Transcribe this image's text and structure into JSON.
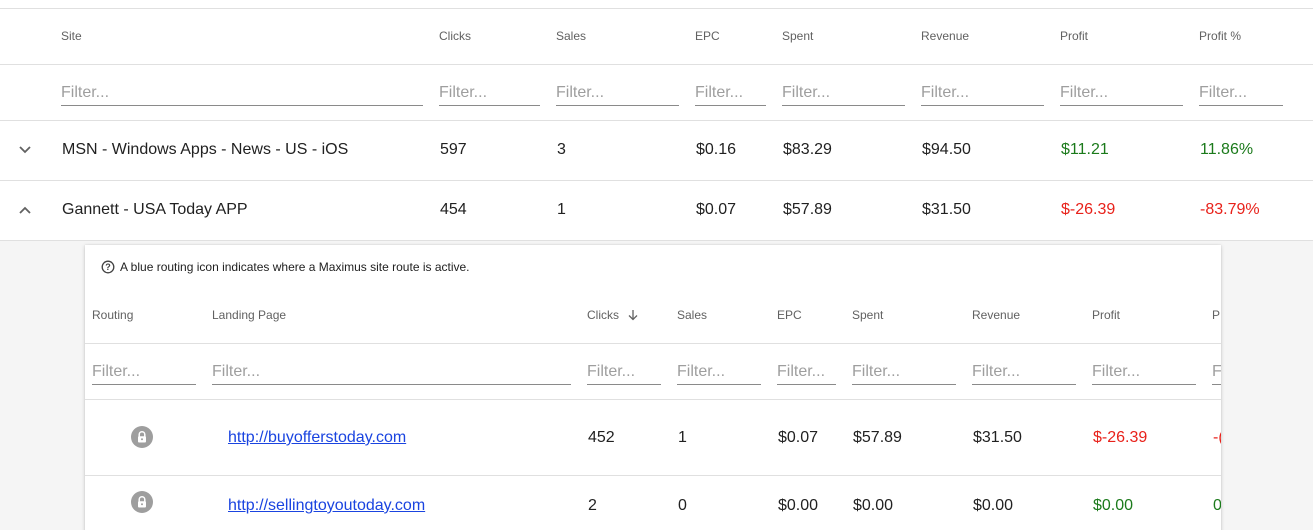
{
  "outer": {
    "columns": [
      "Site",
      "Clicks",
      "Sales",
      "EPC",
      "Spent",
      "Revenue",
      "Profit",
      "Profit %"
    ],
    "filter_placeholder": "Filter...",
    "rows": [
      {
        "expanded": false,
        "site": "MSN - Windows Apps - News - US - iOS",
        "clicks": "597",
        "sales": "3",
        "epc": "$0.16",
        "spent": "$83.29",
        "revenue": "$94.50",
        "profit": "$11.21",
        "profit_pct": "11.86%",
        "status": "positive"
      },
      {
        "expanded": true,
        "site": "Gannett - USA Today APP",
        "clicks": "454",
        "sales": "1",
        "epc": "$0.07",
        "spent": "$57.89",
        "revenue": "$31.50",
        "profit": "$-26.39",
        "profit_pct": "-83.79%",
        "status": "negative"
      }
    ]
  },
  "inner": {
    "note": "A blue routing icon indicates where a Maximus site route is active.",
    "columns": [
      "Routing",
      "Landing Page",
      "Clicks",
      "Sales",
      "EPC",
      "Spent",
      "Revenue",
      "Profit",
      "P"
    ],
    "sort_column": "Clicks",
    "sort_direction": "descending",
    "filter_placeholder": "Filter...",
    "filter_last": "F",
    "rows": [
      {
        "routing_icon": "lock-icon",
        "landing_page": "http://buyofferstoday.com",
        "clicks": "452",
        "sales": "1",
        "epc": "$0.07",
        "spent": "$57.89",
        "revenue": "$31.50",
        "profit": "$-26.39",
        "profit_pct_partial": "-(",
        "status": "negative"
      },
      {
        "routing_icon": "lock-icon",
        "landing_page": "http://sellingtoyoutoday.com",
        "clicks": "2",
        "sales": "0",
        "epc": "$0.00",
        "spent": "$0.00",
        "revenue": "$0.00",
        "profit": "$0.00",
        "profit_pct_partial": "0",
        "status": "positive"
      }
    ]
  },
  "colors": {
    "positive": "#1b7a1b",
    "negative": "#e8211a",
    "link": "#1a44e0"
  }
}
